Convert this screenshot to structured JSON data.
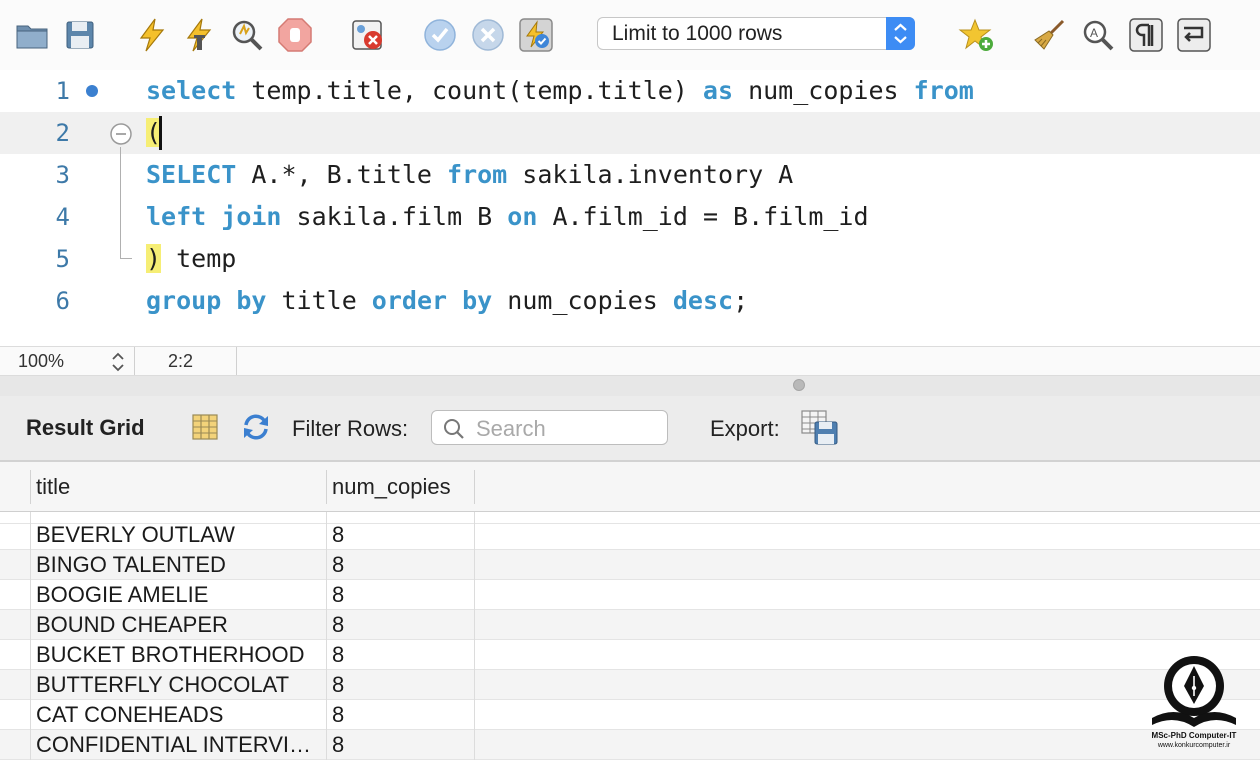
{
  "toolbar": {
    "buttons": [
      {
        "icon": "open-folder-icon"
      },
      {
        "icon": "save-icon"
      },
      {
        "icon": "execute-lightning-icon"
      },
      {
        "icon": "execute-current-lightning-icon"
      },
      {
        "icon": "explain-magnifier-icon"
      },
      {
        "icon": "stop-icon"
      },
      {
        "icon": "toggle-error-icon"
      },
      {
        "icon": "commit-check-icon"
      },
      {
        "icon": "rollback-x-icon"
      },
      {
        "icon": "autocommit-icon"
      },
      {
        "icon": "snippet-star-icon"
      },
      {
        "icon": "beautify-broom-icon"
      },
      {
        "icon": "find-icon"
      },
      {
        "icon": "invisible-chars-icon"
      },
      {
        "icon": "wrap-lines-icon"
      }
    ],
    "limit_select": {
      "value": "Limit to 1000 rows"
    }
  },
  "editor": {
    "lines": [
      {
        "number": "1"
      },
      {
        "number": "2"
      },
      {
        "number": "3"
      },
      {
        "number": "4"
      },
      {
        "number": "5"
      },
      {
        "number": "6"
      }
    ],
    "tokens": {
      "l1": {
        "k1": "select",
        "t1": " temp.title, count(temp.title) ",
        "k2": "as",
        "t2": " num_copies ",
        "k3": "from"
      },
      "l2": {
        "p": "("
      },
      "l3": {
        "k1": "SELECT",
        "t1": " A.*, B.title ",
        "k2": "from",
        "t2": " sakila.inventory A"
      },
      "l4": {
        "k1": "left",
        "sp1": " ",
        "k2": "join",
        "t1": " sakila.film B ",
        "k3": "on",
        "t2": " A.film_id = B.film_id"
      },
      "l5": {
        "p": ")",
        "t1": " temp"
      },
      "l6": {
        "k1": "group",
        "sp1": " ",
        "k2": "by",
        "t1": " title ",
        "k3": "order",
        "sp2": " ",
        "k4": "by",
        "t2": " num_copies ",
        "k5": "desc",
        "t3": ";"
      }
    },
    "colors": {
      "keyword": "#3a93c9",
      "line_number": "#3d79a8",
      "bracket_highlight": "#f6ee75"
    }
  },
  "status_bar": {
    "zoom": "100%",
    "cursor_position": "2:2"
  },
  "result": {
    "title": "Result Grid",
    "filter_label": "Filter Rows:",
    "search_placeholder": "Search",
    "export_label": "Export:",
    "columns": [
      "title",
      "num_copies"
    ],
    "rows": [
      {
        "title": "BEVERLY OUTLAW",
        "num_copies": "8"
      },
      {
        "title": "BINGO TALENTED",
        "num_copies": "8"
      },
      {
        "title": "BOOGIE AMELIE",
        "num_copies": "8"
      },
      {
        "title": "BOUND CHEAPER",
        "num_copies": "8"
      },
      {
        "title": "BUCKET BROTHERHOOD",
        "num_copies": "8"
      },
      {
        "title": "BUTTERFLY CHOCOLAT",
        "num_copies": "8"
      },
      {
        "title": "CAT CONEHEADS",
        "num_copies": "8"
      },
      {
        "title": "CONFIDENTIAL INTERVI…",
        "num_copies": "8"
      }
    ]
  },
  "watermark": {
    "line1": "MSc-PhD Computer-IT",
    "line2": "www.konkurcomputer.ir"
  }
}
